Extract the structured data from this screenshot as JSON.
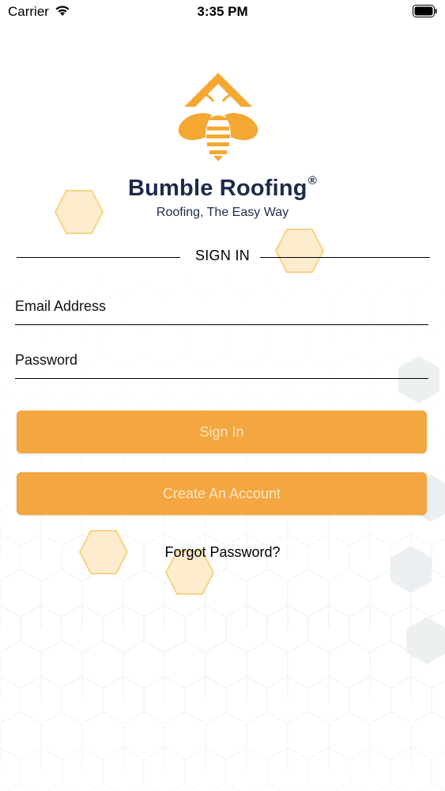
{
  "status_bar": {
    "carrier": "Carrier",
    "time": "3:35 PM"
  },
  "brand": {
    "name": "Bumble Roofing",
    "registered": "®",
    "tagline": "Roofing, The Easy Way"
  },
  "sign_in": {
    "title": "SIGN IN",
    "email_placeholder": "Email Address",
    "password_placeholder": "Password",
    "sign_in_label": "Sign In",
    "create_account_label": "Create An Account",
    "forgot_password_label": "Forgot Password?"
  },
  "colors": {
    "accent": "#f4a640",
    "brand_text": "#1d2b4a",
    "hex_fill": "#fdebc9",
    "hex_stroke": "#f7cf7a"
  }
}
